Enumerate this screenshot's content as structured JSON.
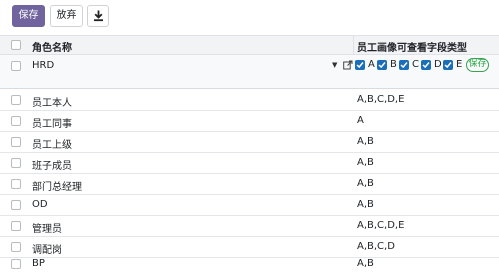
{
  "toolbar": {
    "save_label": "保存",
    "discard_label": "放弃",
    "download_icon": "download-icon"
  },
  "table": {
    "columns": [
      "角色名称",
      "员工画像可查看字段类型"
    ],
    "edit_row": {
      "name": "HRD",
      "options": [
        {
          "label": "A",
          "checked": true
        },
        {
          "label": "B",
          "checked": true
        },
        {
          "label": "C",
          "checked": true
        },
        {
          "label": "D",
          "checked": true
        },
        {
          "label": "E",
          "checked": true
        }
      ],
      "save_label": "保存"
    },
    "rows": [
      {
        "name": "员工本人",
        "types": "A,B,C,D,E"
      },
      {
        "name": "员工同事",
        "types": "A"
      },
      {
        "name": "员工上级",
        "types": "A,B"
      },
      {
        "name": "班子成员",
        "types": "A,B"
      },
      {
        "name": "部门总经理",
        "types": "A,B"
      },
      {
        "name": "OD",
        "types": "A,B"
      },
      {
        "name": "管理员",
        "types": "A,B,C,D,E"
      },
      {
        "name": "调配岗",
        "types": "A,B,C,D"
      },
      {
        "name": "BP",
        "types": "A,B"
      }
    ]
  },
  "colors": {
    "primary": "#71639e",
    "checkbox_checked": "#1b6fb8",
    "save_pill": "#28a745",
    "header_bg": "#f2f3f5"
  }
}
